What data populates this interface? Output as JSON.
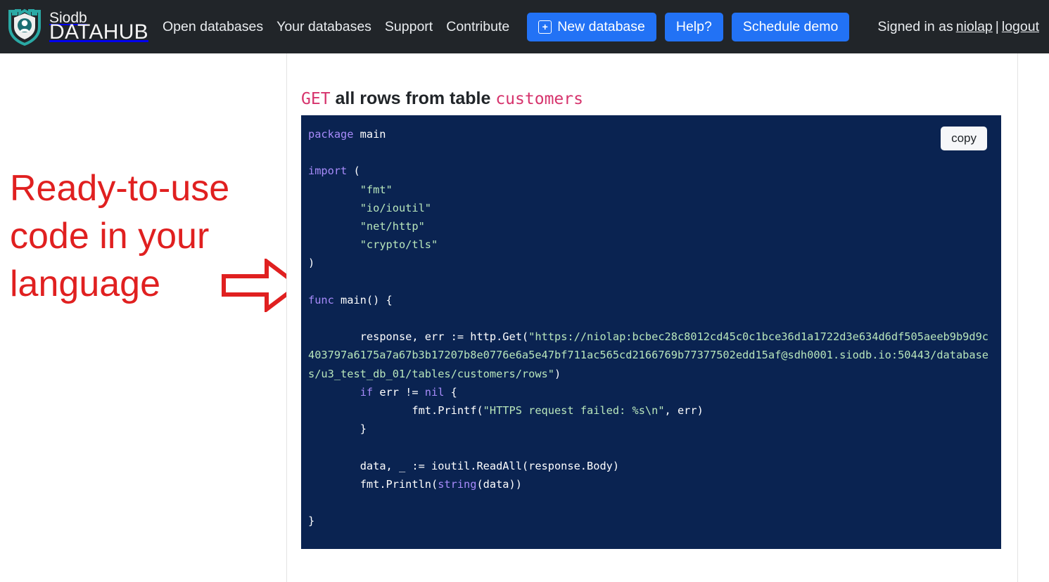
{
  "nav": {
    "brand": {
      "line1": "Siodb",
      "line2": "DATAHUB",
      "logo_icon": "shield-castle-logo"
    },
    "links": [
      {
        "label": "Open databases",
        "name": "nav-link-open-databases"
      },
      {
        "label": "Your databases",
        "name": "nav-link-your-databases"
      },
      {
        "label": "Support",
        "name": "nav-link-support"
      },
      {
        "label": "Contribute",
        "name": "nav-link-contribute"
      }
    ],
    "buttons": {
      "new_database": "New database",
      "new_database_icon": "plus-square-icon",
      "help": "Help?",
      "schedule_demo": "Schedule demo"
    },
    "session": {
      "prefix": "Signed in as",
      "username": "niolap",
      "separator": "|",
      "logout": "logout"
    },
    "accent_color": "#2272f5",
    "background_color": "#212529"
  },
  "annotation": {
    "text": "Ready-to-use\ncode in your\nlanguage",
    "color": "#e02020",
    "arrow_icon": "right-arrow-outline-icon"
  },
  "heading": {
    "method": "GET",
    "middle": " all rows from table ",
    "table": "customers",
    "method_color": "#d6336c"
  },
  "code_panel": {
    "copy_label": "copy",
    "language": "go",
    "background_color": "#0a2351",
    "url": "https://niolap:bcbec28c8012cd45c0c1bce36d1a1722d3e634d6df505aeeb9b9d9c403797a6175a7a67b3b17207b8e0776e6a5e47bf711ac565cd2166769b77377502edd15af@sdh0001.siodb.io:50443/databases/u3_test_db_01/tables/customers/rows",
    "code_segments": [
      {
        "t": "kw",
        "v": "package"
      },
      {
        "t": "pl",
        "v": " main\n\n"
      },
      {
        "t": "kw",
        "v": "import"
      },
      {
        "t": "pl",
        "v": " (\n        "
      },
      {
        "t": "str",
        "v": "\"fmt\""
      },
      {
        "t": "pl",
        "v": "\n        "
      },
      {
        "t": "str",
        "v": "\"io/ioutil\""
      },
      {
        "t": "pl",
        "v": "\n        "
      },
      {
        "t": "str",
        "v": "\"net/http\""
      },
      {
        "t": "pl",
        "v": "\n        "
      },
      {
        "t": "str",
        "v": "\"crypto/tls\""
      },
      {
        "t": "pl",
        "v": "\n)\n\n"
      },
      {
        "t": "kw",
        "v": "func"
      },
      {
        "t": "pl",
        "v": " main() {\n\n        response, err := http.Get("
      },
      {
        "t": "str",
        "v": "\"https://niolap:bcbec28c8012cd45c0c1bce36d1a1722d3e634d6df505aeeb9b9d9c403797a6175a7a67b3b17207b8e0776e6a5e47bf711ac565cd2166769b77377502edd15af@sdh0001.siodb.io:50443/databases/u3_test_db_01/tables/customers/rows\""
      },
      {
        "t": "pl",
        "v": ")\n        "
      },
      {
        "t": "kw",
        "v": "if"
      },
      {
        "t": "pl",
        "v": " err != "
      },
      {
        "t": "kw",
        "v": "nil"
      },
      {
        "t": "pl",
        "v": " {\n                fmt.Printf("
      },
      {
        "t": "str",
        "v": "\"HTTPS request failed: %s\\n\""
      },
      {
        "t": "pl",
        "v": ", err)\n        }\n\n        data, _ := ioutil.ReadAll(response.Body)\n        fmt.Println("
      },
      {
        "t": "kw",
        "v": "string"
      },
      {
        "t": "pl",
        "v": "(data))\n\n}"
      }
    ]
  }
}
